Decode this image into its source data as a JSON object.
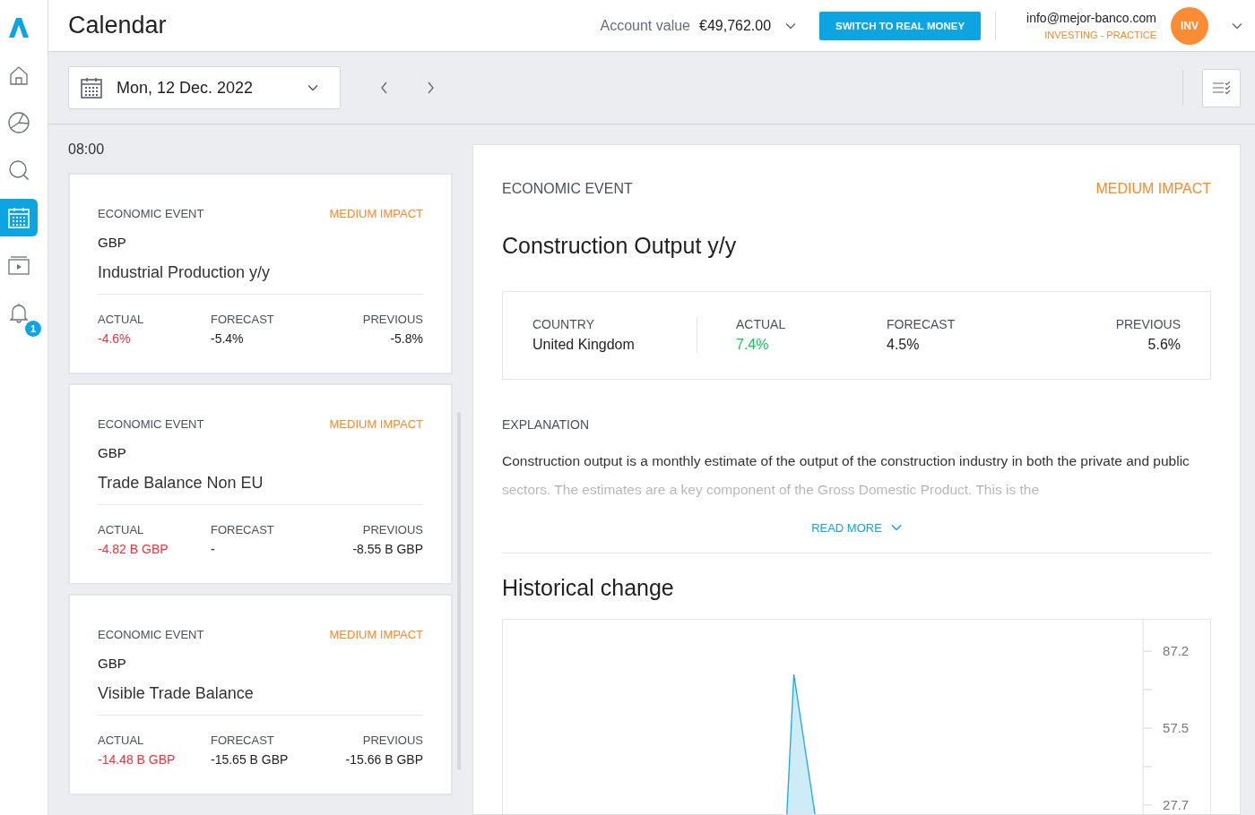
{
  "sidebar": {
    "items": [
      {
        "kind": "home",
        "selected": false
      },
      {
        "kind": "portfolio",
        "selected": false
      },
      {
        "kind": "search",
        "selected": false
      },
      {
        "kind": "calendar",
        "selected": true
      },
      {
        "kind": "video",
        "selected": false
      },
      {
        "kind": "bell",
        "selected": false,
        "badge": "1"
      }
    ]
  },
  "header": {
    "title": "Calendar",
    "account_label": "Account value",
    "account_value": "€49,762.00",
    "switch_button": "SWITCH TO REAL MONEY",
    "email": "info@mejor-banco.com",
    "mode": "INVESTING - PRACTICE",
    "avatar": "INV"
  },
  "toolbar": {
    "date": "Mon, 12 Dec. 2022"
  },
  "time": "08:00",
  "events": [
    {
      "type_label": "ECONOMIC EVENT",
      "impact": "MEDIUM IMPACT",
      "currency": "GBP",
      "name": "Industrial Production y/y",
      "figures": [
        {
          "label": "ACTUAL",
          "value": "-4.6%",
          "color": "#f0303d"
        },
        {
          "label": "FORECAST",
          "value": "-5.4%"
        },
        {
          "label": "PREVIOUS",
          "value": "-5.8%"
        }
      ]
    },
    {
      "type_label": "ECONOMIC EVENT",
      "impact": "MEDIUM IMPACT",
      "currency": "GBP",
      "name": "Trade Balance Non EU",
      "figures": [
        {
          "label": "ACTUAL",
          "value": "-4.82 B GBP",
          "color": "#f0303d"
        },
        {
          "label": "FORECAST",
          "value": "-"
        },
        {
          "label": "PREVIOUS",
          "value": "-8.55 B GBP"
        }
      ]
    },
    {
      "type_label": "ECONOMIC EVENT",
      "impact": "MEDIUM IMPACT",
      "currency": "GBP",
      "name": "Visible Trade Balance",
      "figures": [
        {
          "label": "ACTUAL",
          "value": "-14.48 B GBP",
          "color": "#f0303d"
        },
        {
          "label": "FORECAST",
          "value": "-15.65 B GBP"
        },
        {
          "label": "PREVIOUS",
          "value": "-15.66 B GBP"
        }
      ]
    }
  ],
  "detail": {
    "type_label": "ECONOMIC EVENT",
    "impact": "MEDIUM IMPACT",
    "title": "Construction Output y/y",
    "facts": [
      {
        "label": "COUNTRY",
        "value": "United Kingdom"
      },
      {
        "label": "ACTUAL",
        "value": "7.4%",
        "color": "#1fbf5f"
      },
      {
        "label": "FORECAST",
        "value": "4.5%"
      },
      {
        "label": "PREVIOUS",
        "value": "5.6%"
      }
    ],
    "explanation_heading": "EXPLANATION",
    "explanation": "Construction output is a monthly estimate of the output of the construction industry in both the private and public sectors. The estimates are a key component of the Gross Domestic Product. This is the",
    "read_more": "READ MORE",
    "history_title": "Historical change",
    "chart": {
      "y_labels": [
        "87.2",
        "57.5",
        "27.7"
      ]
    }
  }
}
